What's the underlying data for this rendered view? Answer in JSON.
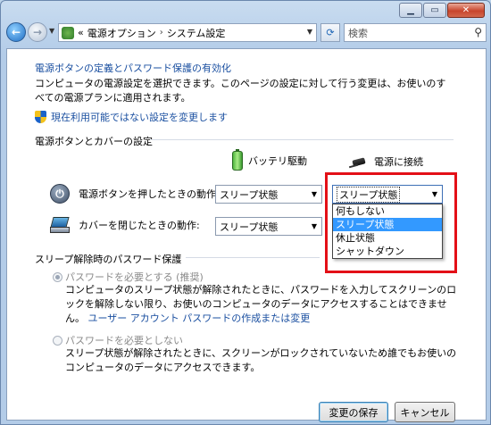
{
  "nav": {
    "breadcrumb_prefix": "«",
    "breadcrumb_1": "電源オプション",
    "breadcrumb_sep": "›",
    "breadcrumb_2": "システム設定",
    "search_placeholder": "検索"
  },
  "content": {
    "title": "電源ボタンの定義とパスワード保護の有効化",
    "description": "コンピュータの電源設定を選択できます。このページの設定に対して行う変更は、お使いのすべての電源プランに適用されます。",
    "change_unavailable_link": "現在利用可能ではない設定を変更します",
    "buttons_section_title": "電源ボタンとカバーの設定",
    "col_battery": "バッテリ駆動",
    "col_plugged": "電源に接続",
    "power_button_label": "電源ボタンを押したときの動作:",
    "power_button_battery_value": "スリープ状態",
    "power_button_plugged_value": "スリープ状態",
    "lid_label": "カバーを閉じたときの動作:",
    "lid_battery_value": "スリープ状態",
    "dropdown_options": [
      "何もしない",
      "スリープ状態",
      "休止状態",
      "シャットダウン"
    ],
    "password_section_title": "スリープ解除時のパスワード保護",
    "require_password_label": "パスワードを必要とする (推奨)",
    "require_password_desc": "コンピュータのスリープ状態が解除されたときに、パスワードを入力してスクリーンのロックを解除しない限り、お使いのコンピュータのデータにアクセスすることはできません。",
    "user_account_link": "ユーザー アカウント パスワードの作成または変更",
    "no_password_label": "パスワードを必要としない",
    "no_password_desc": "スリープ状態が解除されたときに、スクリーンがロックされていないため誰でもお使いのコンピュータのデータにアクセスできます。",
    "save_button": "変更の保存",
    "cancel_button": "キャンセル"
  },
  "colors": {
    "link": "#1a4fa0",
    "highlight_border": "#e31017",
    "selection": "#3399ff"
  }
}
